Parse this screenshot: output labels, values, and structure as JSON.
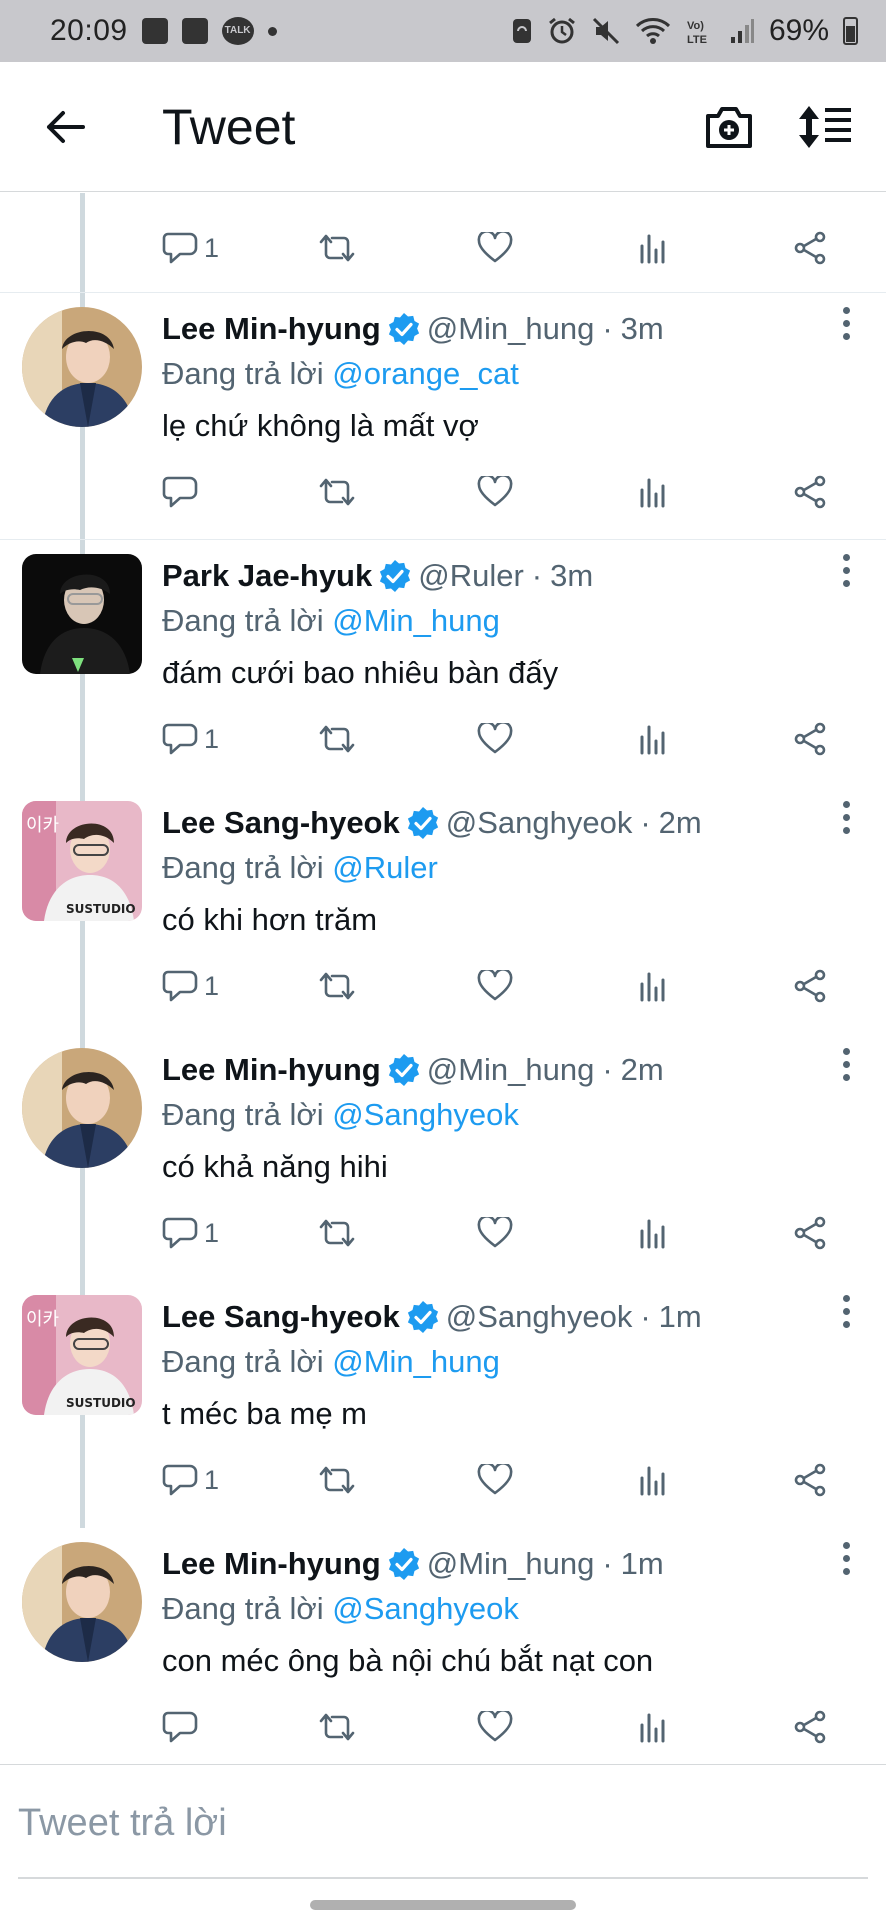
{
  "status_bar": {
    "time": "20:09",
    "battery": "69%",
    "left_icons": [
      "gallery-icon",
      "shop-icon",
      "talk-icon",
      "dot-icon"
    ],
    "talk_label": "TALK",
    "right_icons": [
      "sync-icon",
      "alarm-icon",
      "mute-icon",
      "wifi-icon",
      "volte-icon",
      "signal-icon",
      "battery-icon"
    ]
  },
  "header": {
    "title": "Tweet",
    "back_icon": "arrow-left-icon",
    "camera_icon": "camera-plus-icon",
    "sort_icon": "sort-icon"
  },
  "partial_tweet": {
    "reply_count": "1"
  },
  "reply_prefix": "Đang trả lời ",
  "tweets": [
    {
      "name": "Lee Min-hyung",
      "handle": "@Min_hung",
      "time": "3m",
      "reply_to": "@orange_cat",
      "text": "lẹ chứ không là mất vợ",
      "reply_count": "",
      "avatar": "min-hyung"
    },
    {
      "name": "Park Jae-hyuk",
      "handle": "@Ruler",
      "time": "3m",
      "reply_to": "@Min_hung",
      "text": "đám cưới bao nhiêu bàn đấy",
      "reply_count": "1",
      "avatar": "jae-hyuk"
    },
    {
      "name": "Lee Sang-hyeok",
      "handle": "@Sanghyeok",
      "time": "2m",
      "reply_to": "@Ruler",
      "text": "có khi hơn trăm",
      "reply_count": "1",
      "avatar": "sang-hyeok"
    },
    {
      "name": "Lee Min-hyung",
      "handle": "@Min_hung",
      "time": "2m",
      "reply_to": "@Sanghyeok",
      "text": "có khả năng hihi",
      "reply_count": "1",
      "avatar": "min-hyung"
    },
    {
      "name": "Lee Sang-hyeok",
      "handle": "@Sanghyeok",
      "time": "1m",
      "reply_to": "@Min_hung",
      "text": "t méc ba mẹ m",
      "reply_count": "1",
      "avatar": "sang-hyeok"
    },
    {
      "name": "Lee Min-hyung",
      "handle": "@Min_hung",
      "time": "1m",
      "reply_to": "@Sanghyeok",
      "text": "con méc ông bà nội chú bắt nạt con",
      "reply_count": "",
      "avatar": "min-hyung"
    }
  ],
  "composer": {
    "placeholder": "Tweet trả lời"
  },
  "colors": {
    "accent": "#1d9bf0",
    "text": "#0f1419",
    "muted": "#536471",
    "status_bar": "#c8c8cc"
  }
}
